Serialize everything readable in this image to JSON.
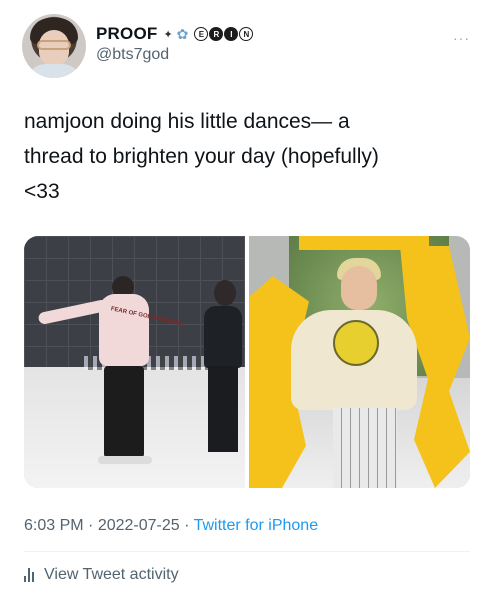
{
  "author": {
    "display_name": "PROOF",
    "handle": "@bts7god",
    "badges": [
      "E",
      "R",
      "I",
      "N"
    ]
  },
  "tweet": {
    "text": "namjoon doing his little dances— a\nthread to brighten your day (hopefully)\n<33"
  },
  "meta": {
    "time": "6:03 PM",
    "separator_1": " · ",
    "date": "2022-07-25",
    "separator_2": " · ",
    "source": "Twitter for iPhone"
  },
  "actions": {
    "view_activity": "View Tweet activity"
  },
  "media": {
    "left_print": "FEAR OF GOD BASEBALL"
  },
  "colors": {
    "accent": "#1d9bf0",
    "muted": "#536471",
    "yellow": "#f4c21a"
  }
}
